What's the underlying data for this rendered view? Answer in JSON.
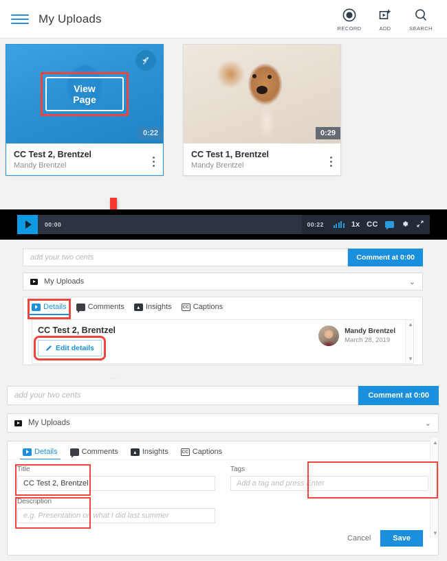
{
  "appbar": {
    "title": "My Uploads",
    "menu_icon": "hamburger-icon",
    "actions": [
      {
        "label": "RECORD",
        "icon": "record-icon"
      },
      {
        "label": "ADD",
        "icon": "add-video-icon"
      },
      {
        "label": "SEARCH",
        "icon": "search-icon"
      }
    ]
  },
  "cards": [
    {
      "title": "CC Test 2, Brentzel",
      "owner": "Mandy Brentzel",
      "duration": "0:22",
      "hover_button": "View Page",
      "badge_icon": "rocket-icon",
      "menu_icon": "kebab-menu-icon",
      "hovered": true
    },
    {
      "title": "CC Test 1, Brentzel",
      "owner": "Mandy Brentzel",
      "duration": "0:29",
      "menu_icon": "kebab-menu-icon",
      "hovered": false
    }
  ],
  "player": {
    "play_icon": "play-icon",
    "current_time": "00:00",
    "total_time": "00:22",
    "volume_icon": "volume-bars-icon",
    "speed": "1x",
    "captions": "CC",
    "comment_icon": "comment-bubble-icon",
    "settings_icon": "gear-icon",
    "fullscreen_icon": "fullscreen-icon"
  },
  "middle": {
    "comment_placeholder": "add your two cents",
    "comment_button": "Comment at 0:00",
    "channel": "My Uploads",
    "channel_icon": "video-library-icon",
    "chevron_icon": "chevron-down-icon",
    "tabs": [
      {
        "label": "Details",
        "icon": "details-icon",
        "active": true
      },
      {
        "label": "Comments",
        "icon": "comments-icon",
        "active": false
      },
      {
        "label": "Insights",
        "icon": "insights-icon",
        "active": false
      },
      {
        "label": "Captions",
        "icon": "captions-icon",
        "active": false
      }
    ],
    "detail_title": "CC Test 2, Brentzel",
    "edit_button": "Edit details",
    "edit_icon": "pencil-icon",
    "owner_name": "Mandy Brentzel",
    "owner_date": "March 28, 2019",
    "avatar_icon": "avatar"
  },
  "bottom": {
    "comment_placeholder": "add your two cents",
    "comment_button": "Comment at 0:00",
    "channel": "My Uploads",
    "channel_icon": "video-library-icon",
    "chevron_icon": "chevron-down-icon",
    "tabs": [
      {
        "label": "Details",
        "icon": "details-icon",
        "active": true
      },
      {
        "label": "Comments",
        "icon": "comments-icon",
        "active": false
      },
      {
        "label": "Insights",
        "icon": "insights-icon",
        "active": false
      },
      {
        "label": "Captions",
        "icon": "captions-icon",
        "active": false
      }
    ],
    "title_label": "Title",
    "title_value": "CC Test 2, Brentzel",
    "description_label": "Description",
    "description_placeholder": "e.g. Presentation on what I did last summer",
    "tags_label": "Tags",
    "tags_placeholder": "Add a tag and press Enter",
    "cancel_button": "Cancel",
    "save_button": "Save"
  },
  "colors": {
    "accent": "#1a8fdd",
    "highlight": "#f0443c",
    "player_bg": "#2b3440",
    "page_bg": "#f2f2f2"
  }
}
